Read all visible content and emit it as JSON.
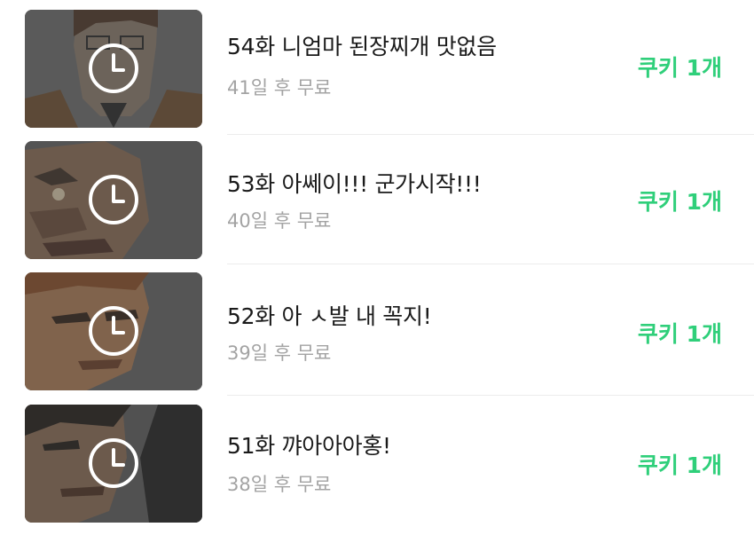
{
  "episodes": [
    {
      "title": "54화 니엄마 된장찌개 맛없음",
      "free_in": "41일 후 무료",
      "price": "쿠키 1개",
      "thumb_icon": "clock-icon"
    },
    {
      "title": "53화 아쎄이!!! 군가시작!!!",
      "free_in": "40일 후 무료",
      "price": "쿠키 1개",
      "thumb_icon": "clock-icon"
    },
    {
      "title": "52화 아 ㅅ발 내 꼭지!",
      "free_in": "39일 후 무료",
      "price": "쿠키 1개",
      "thumb_icon": "clock-icon"
    },
    {
      "title": "51화 꺄아아아홍!",
      "free_in": "38일 후 무료",
      "price": "쿠키 1개",
      "thumb_icon": "clock-icon"
    }
  ],
  "colors": {
    "price": "#2fcf7a",
    "title": "#1a1a1a",
    "subtitle": "#a3a3a3",
    "divider": "#ececec"
  }
}
